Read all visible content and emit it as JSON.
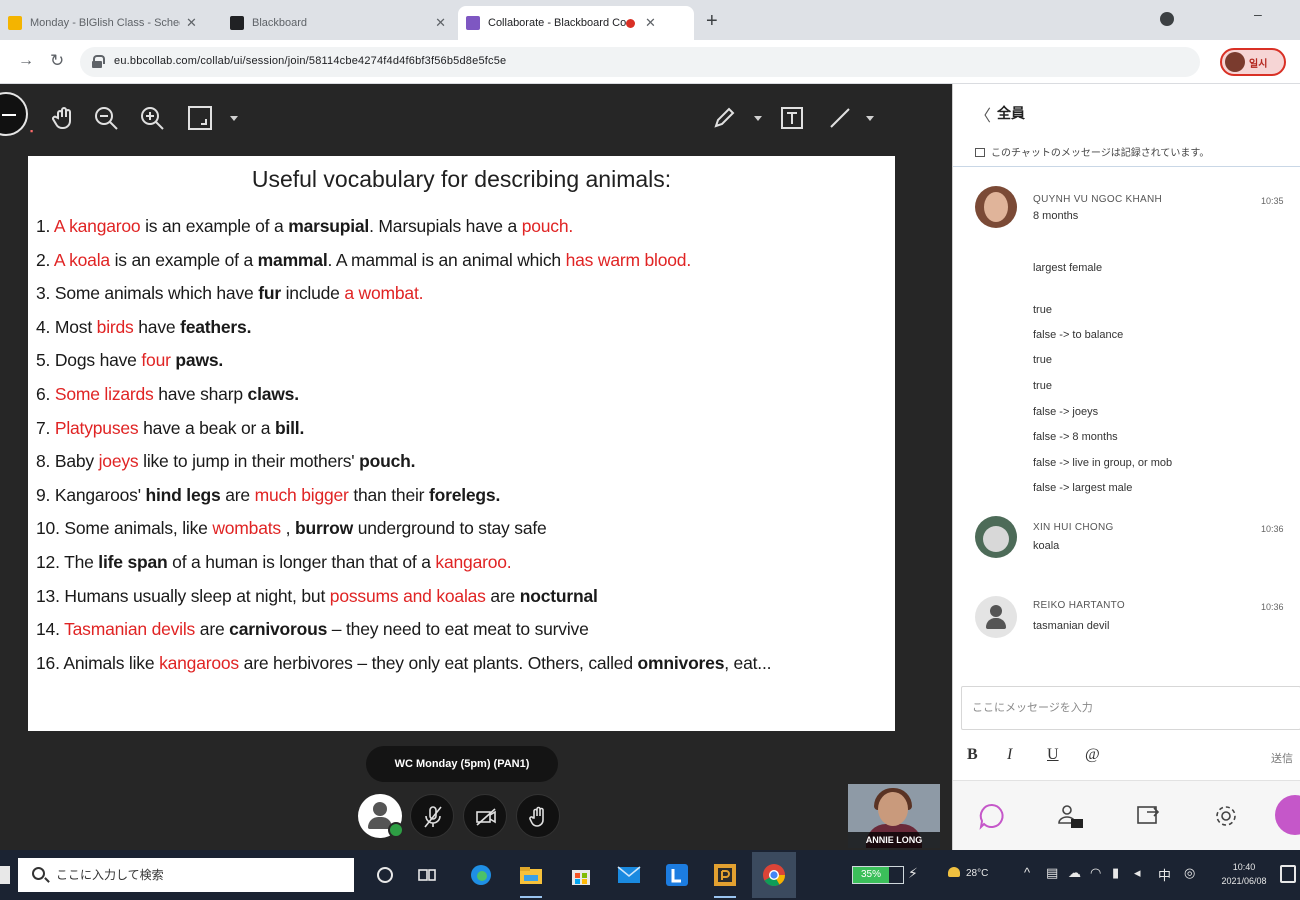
{
  "browser": {
    "tabs": [
      {
        "title": "Monday - BlGlish Class - Schedule",
        "active": false
      },
      {
        "title": "Blackboard",
        "active": false
      },
      {
        "title": "Collaborate - Blackboard Collaborate",
        "active": true
      }
    ],
    "url": "eu.bbcollab.com/collab/ui/session/join/58114cbe4274f4d4f6bf3f56b5d8e5fc5e",
    "profile_label": "일시",
    "colors": {
      "tab_strip": "#dee1e6",
      "profile_accent": "#d93025"
    }
  },
  "stage": {
    "slide": {
      "title": "Useful vocabulary for describing animals:",
      "lines": [
        [
          {
            "t": "1. "
          },
          {
            "t": "A kangaroo",
            "s": "red"
          },
          {
            "t": " is an example of a "
          },
          {
            "t": "marsupial",
            "s": "bold"
          },
          {
            "t": ". Marsupials have a "
          },
          {
            "t": "pouch.",
            "s": "red"
          }
        ],
        [
          {
            "t": "2. "
          },
          {
            "t": "A koala",
            "s": "red"
          },
          {
            "t": " is an example of a "
          },
          {
            "t": "mammal",
            "s": "bold"
          },
          {
            "t": ". A mammal is an animal which "
          },
          {
            "t": "has warm blood.",
            "s": "red"
          }
        ],
        [
          {
            "t": "3. Some animals which have "
          },
          {
            "t": "fur",
            "s": "bold"
          },
          {
            "t": " include "
          },
          {
            "t": "a wombat.",
            "s": "red"
          }
        ],
        [
          {
            "t": "4. Most "
          },
          {
            "t": "birds",
            "s": "red"
          },
          {
            "t": " have "
          },
          {
            "t": "feathers.",
            "s": "bold"
          }
        ],
        [
          {
            "t": "5. Dogs have "
          },
          {
            "t": "four",
            "s": "red"
          },
          {
            "t": " "
          },
          {
            "t": "paws.",
            "s": "bold"
          }
        ],
        [
          {
            "t": "6. "
          },
          {
            "t": "Some lizards",
            "s": "red"
          },
          {
            "t": " have sharp "
          },
          {
            "t": "claws.",
            "s": "bold"
          }
        ],
        [
          {
            "t": "7. "
          },
          {
            "t": "Platypuses",
            "s": "red"
          },
          {
            "t": " have a beak or a "
          },
          {
            "t": "bill.",
            "s": "bold"
          }
        ],
        [
          {
            "t": "8. Baby "
          },
          {
            "t": "joeys",
            "s": "red"
          },
          {
            "t": " like to jump in their mothers' "
          },
          {
            "t": "pouch.",
            "s": "bold"
          }
        ],
        [
          {
            "t": "9. Kangaroos' "
          },
          {
            "t": "hind legs",
            "s": "bold"
          },
          {
            "t": " are "
          },
          {
            "t": "much bigger",
            "s": "red"
          },
          {
            "t": " than their "
          },
          {
            "t": "forelegs.",
            "s": "bold"
          }
        ],
        [
          {
            "t": "10. Some animals, like "
          },
          {
            "t": "wombats",
            "s": "red"
          },
          {
            "t": " , "
          },
          {
            "t": "burrow",
            "s": "bold"
          },
          {
            "t": " underground to stay safe"
          }
        ],
        [
          {
            "t": "12. The "
          },
          {
            "t": "life span",
            "s": "bold"
          },
          {
            "t": " of a human is longer than that of a "
          },
          {
            "t": "kangaroo.",
            "s": "red"
          }
        ],
        [
          {
            "t": "13. Humans usually sleep at night, but "
          },
          {
            "t": "possums and koalas",
            "s": "red"
          },
          {
            "t": " are "
          },
          {
            "t": "nocturnal",
            "s": "bold"
          }
        ],
        [
          {
            "t": "14. "
          },
          {
            "t": "Tasmanian devils",
            "s": "red"
          },
          {
            "t": " are "
          },
          {
            "t": "carnivorous",
            "s": "bold"
          },
          {
            "t": " – they need to eat meat to survive"
          }
        ],
        [
          {
            "t": "16. Animals like "
          },
          {
            "t": "kangaroos",
            "s": "red"
          },
          {
            "t": " are herbivores – they only eat plants. Others, called "
          },
          {
            "t": "omnivores",
            "s": "bold"
          },
          {
            "t": ", eat..."
          }
        ]
      ],
      "colors": {
        "highlight": "#e02424",
        "text": "#1a1a1a"
      }
    },
    "session_label": "WC Monday (5pm) (PAN1)",
    "participant_name": "ANNIE LONG"
  },
  "chat": {
    "title": "全員",
    "notice": "このチャットのメッセージは記録されています。",
    "messages": [
      {
        "name": "QUYNH VU NGOC KHANH",
        "time": "10:35",
        "lines": [
          "8 months",
          "largest female",
          "true",
          "false -> to balance",
          "true",
          "true",
          "false -> joeys",
          "false -> 8 months",
          "false -> live in group, or mob",
          "false -> largest male"
        ]
      },
      {
        "name": "XIN HUI CHONG",
        "time": "10:36",
        "lines": [
          "koala"
        ]
      },
      {
        "name": "REIKO HARTANTO",
        "time": "10:36",
        "lines": [
          "tasmanian devil"
        ]
      }
    ],
    "input_placeholder": "ここにメッセージを入力",
    "format_labels": {
      "bold": "B",
      "italic": "I",
      "underline": "U",
      "mention": "@"
    },
    "send_label": "送信"
  },
  "taskbar": {
    "search_placeholder": "ここに入力して検索",
    "battery_percent": "35%",
    "weather": "28°C",
    "clock_time": "10:40",
    "clock_date": "2021/06/08"
  }
}
